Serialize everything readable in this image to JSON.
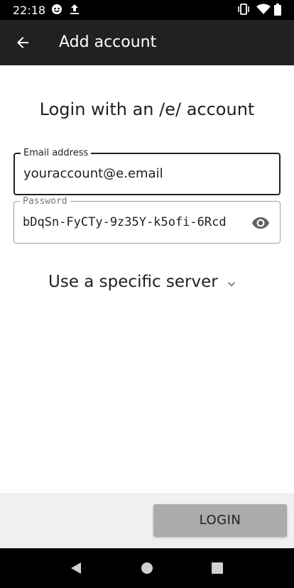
{
  "status_bar": {
    "time": "22:18",
    "icons": [
      "notification-face-icon",
      "upload-icon",
      "vibrate-icon",
      "wifi-icon",
      "battery-icon"
    ]
  },
  "app_bar": {
    "title": "Add account",
    "back_icon": "arrow-back-icon"
  },
  "main": {
    "heading": "Login with an /e/ account",
    "email": {
      "label": "Email address",
      "value": "youraccount@e.email"
    },
    "password": {
      "label": "Password",
      "value": "bDqSn-FyCTy-9z35Y-k5ofi-6Rcd",
      "toggle_icon": "eye-icon"
    },
    "server_toggle": {
      "label": "Use a specific server",
      "icon": "chevron-down-icon"
    }
  },
  "footer": {
    "login_label": "LOGIN"
  },
  "nav_bar": {
    "icons": [
      "back-triangle-icon",
      "home-circle-icon",
      "recents-square-icon"
    ]
  },
  "colors": {
    "app_bar": "#212121",
    "status_bar": "#000000",
    "button": "#ababab",
    "footer": "#f0f0f0"
  }
}
